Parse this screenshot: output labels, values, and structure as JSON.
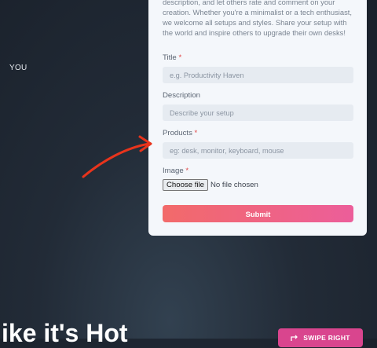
{
  "side_label": "YOU",
  "form": {
    "intro": "description, and let others rate and comment on your creation. Whether you're a minimalist or a tech enthusiast, we welcome all setups and styles. Share your setup with the world and inspire others to upgrade their own desks!",
    "title_label": "Title",
    "title_placeholder": "e.g. Productivity Haven",
    "description_label": "Description",
    "description_placeholder": "Describe your setup",
    "products_label": "Products",
    "products_placeholder": "eg: desk, monitor, keyboard, mouse",
    "image_label": "Image",
    "required_mark": "*",
    "choose_file_label": "Choose file",
    "no_file_text": "No file chosen",
    "submit_label": "Submit"
  },
  "headline": "ike it's Hot",
  "swipe_button_label": "SWIPE RIGHT",
  "colors": {
    "background": "#1e2630",
    "card": "#f4f7fb",
    "accent_start": "#f26a6a",
    "accent_end": "#ec5e9a",
    "annotation_arrow": "#e8341c"
  }
}
